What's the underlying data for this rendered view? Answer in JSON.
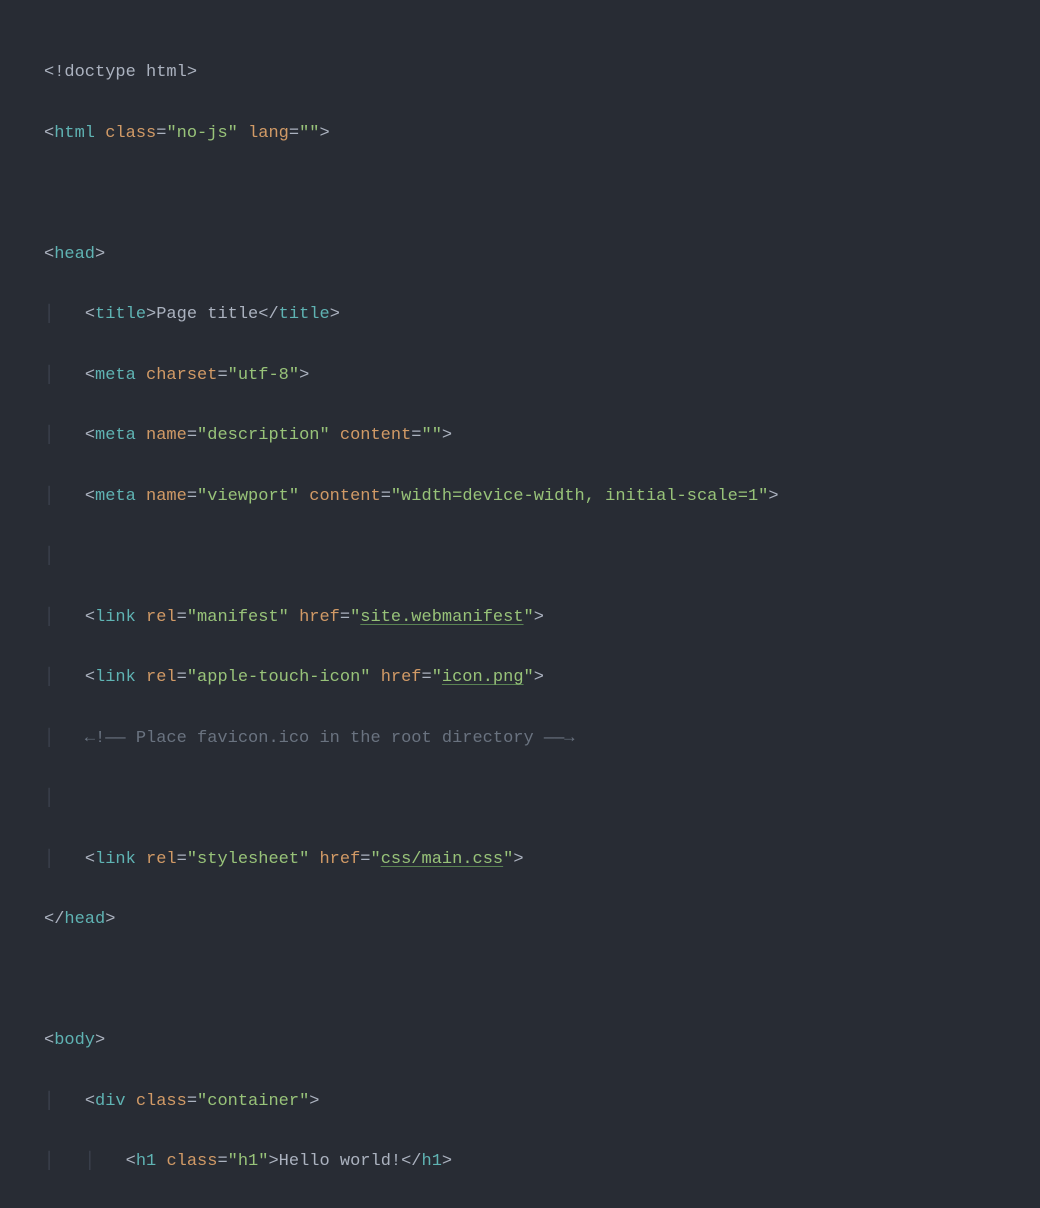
{
  "lines": {
    "l01": {
      "b1": "<!",
      "doctype": "doctype",
      "sp": " ",
      "html": "html",
      "b2": ">"
    },
    "l02": {
      "b1": "<",
      "tag": "html",
      "sp1": " ",
      "a1": "class",
      "eq1": "=",
      "q1a": "\"",
      "v1": "no-js",
      "q1b": "\"",
      "sp2": " ",
      "a2": "lang",
      "eq2": "=",
      "q2a": "\"",
      "v2": "",
      "q2b": "\"",
      "b2": ">"
    },
    "l03": {
      "empty": " "
    },
    "l04": {
      "b1": "<",
      "tag": "head",
      "b2": ">"
    },
    "l05": {
      "indent": "    ",
      "b1": "<",
      "tag": "title",
      "b2": ">",
      "text": "Page title",
      "b3": "</",
      "tag2": "title",
      "b4": ">"
    },
    "l06": {
      "indent": "    ",
      "b1": "<",
      "tag": "meta",
      "sp1": " ",
      "a1": "charset",
      "eq1": "=",
      "q1a": "\"",
      "v1": "utf-8",
      "q1b": "\"",
      "b2": ">"
    },
    "l07": {
      "indent": "    ",
      "b1": "<",
      "tag": "meta",
      "sp1": " ",
      "a1": "name",
      "eq1": "=",
      "q1a": "\"",
      "v1": "description",
      "q1b": "\"",
      "sp2": " ",
      "a2": "content",
      "eq2": "=",
      "q2a": "\"",
      "v2": "",
      "q2b": "\"",
      "b2": ">"
    },
    "l08": {
      "indent": "    ",
      "b1": "<",
      "tag": "meta",
      "sp1": " ",
      "a1": "name",
      "eq1": "=",
      "q1a": "\"",
      "v1": "viewport",
      "q1b": "\"",
      "sp2": " ",
      "a2": "content",
      "eq2": "=",
      "q2a": "\"",
      "v2": "width=device-width, initial-scale=1",
      "q2b": "\"",
      "b2": ">"
    },
    "l09": {
      "empty": " "
    },
    "l10": {
      "indent": "    ",
      "b1": "<",
      "tag": "link",
      "sp1": " ",
      "a1": "rel",
      "eq1": "=",
      "q1a": "\"",
      "v1": "manifest",
      "q1b": "\"",
      "sp2": " ",
      "a2": "href",
      "eq2": "=",
      "q2a": "\"",
      "v2": "site.webmanifest",
      "q2b": "\"",
      "b2": ">"
    },
    "l11": {
      "indent": "    ",
      "b1": "<",
      "tag": "link",
      "sp1": " ",
      "a1": "rel",
      "eq1": "=",
      "q1a": "\"",
      "v1": "apple-touch-icon",
      "q1b": "\"",
      "sp2": " ",
      "a2": "href",
      "eq2": "=",
      "q2a": "\"",
      "v2": "icon.png",
      "q2b": "\"",
      "b2": ">"
    },
    "l12": {
      "indent": "    ",
      "comment": "←!—— Place favicon.ico in the root directory ——→"
    },
    "l13": {
      "empty": " "
    },
    "l14": {
      "indent": "    ",
      "b1": "<",
      "tag": "link",
      "sp1": " ",
      "a1": "rel",
      "eq1": "=",
      "q1a": "\"",
      "v1": "stylesheet",
      "q1b": "\"",
      "sp2": " ",
      "a2": "href",
      "eq2": "=",
      "q2a": "\"",
      "v2": "css/main.css",
      "q2b": "\"",
      "b2": ">"
    },
    "l15": {
      "b1": "</",
      "tag": "head",
      "b2": ">"
    },
    "l16": {
      "empty": " "
    },
    "l17": {
      "b1": "<",
      "tag": "body",
      "b2": ">"
    },
    "l18": {
      "indent": "    ",
      "b1": "<",
      "tag": "div",
      "sp1": " ",
      "a1": "class",
      "eq1": "=",
      "q1a": "\"",
      "v1": "container",
      "q1b": "\"",
      "b2": ">"
    },
    "l19": {
      "indent": "        ",
      "b1": "<",
      "tag": "h1",
      "sp1": " ",
      "a1": "class",
      "eq1": "=",
      "q1a": "\"",
      "v1": "h1",
      "q1b": "\"",
      "b2": ">",
      "text": "Hello world!",
      "b3": "</",
      "tag2": "h1",
      "b4": ">"
    }
  },
  "guides": {
    "g1": "│   ",
    "g2": "│   │   "
  }
}
